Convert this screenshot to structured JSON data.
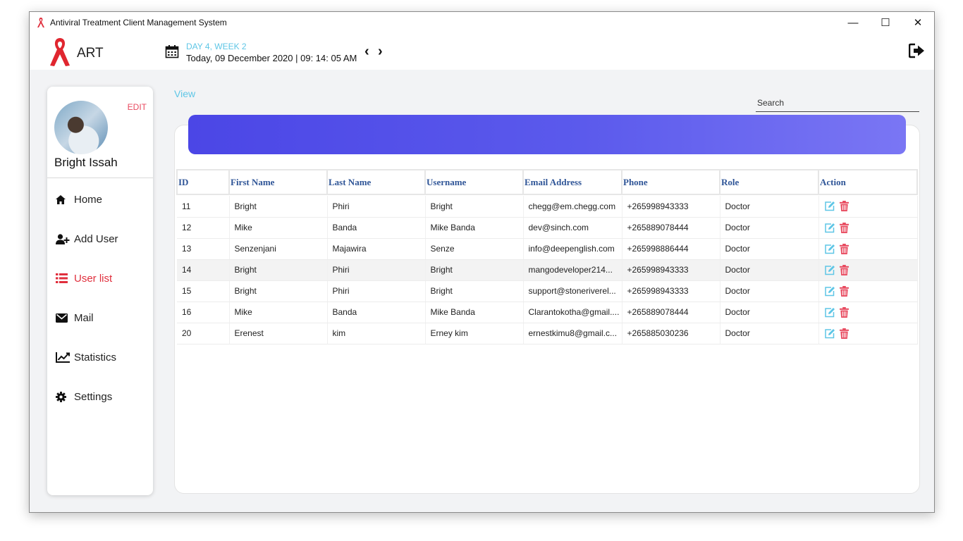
{
  "window": {
    "title": "Antiviral Treatment Client Management System",
    "controls": {
      "minimize": "—",
      "maximize": "☐",
      "close": "✕"
    }
  },
  "header": {
    "brand": "ART",
    "week_label": "DAY 4,  WEEK 2",
    "today": "Today, 09 December 2020  | 09: 14: 05 AM",
    "prev": "‹",
    "next": "›"
  },
  "profile": {
    "name": "Bright Issah",
    "edit_label": "EDIT"
  },
  "sidebar": {
    "items": [
      {
        "label": "Home",
        "icon": "home-icon"
      },
      {
        "label": "Add User",
        "icon": "add-user-icon"
      },
      {
        "label": "User list",
        "icon": "list-icon",
        "active": true
      },
      {
        "label": "Mail",
        "icon": "mail-icon"
      },
      {
        "label": "Statistics",
        "icon": "chart-line-icon"
      },
      {
        "label": "Settings",
        "icon": "gear-icon"
      }
    ]
  },
  "main": {
    "view_label": "View",
    "search_placeholder": "Search",
    "table": {
      "columns": [
        "ID",
        "First Name",
        "Last Name",
        "Username",
        "Email Address",
        "Phone",
        "Role",
        "Action"
      ],
      "rows": [
        [
          "11",
          "Bright",
          "Phiri",
          "Bright",
          "chegg@em.chegg.com",
          "+265998943333",
          "Doctor"
        ],
        [
          "12",
          "Mike",
          "Banda",
          "Mike Banda",
          "dev@sinch.com",
          "+265889078444",
          "Doctor"
        ],
        [
          "13",
          "Senzenjani",
          "Majawira",
          "Senze",
          "info@deepenglish.com",
          "+265998886444",
          "Doctor"
        ],
        [
          "14",
          "Bright",
          "Phiri",
          "Bright",
          "mangodeveloper214...",
          "+265998943333",
          "Doctor"
        ],
        [
          "15",
          "Bright",
          "Phiri",
          "Bright",
          "support@stoneriverel...",
          "+265998943333",
          "Doctor"
        ],
        [
          "16",
          "Mike",
          "Banda",
          "Mike Banda",
          "Clarantokotha@gmail....",
          "+265889078444",
          "Doctor"
        ],
        [
          "20",
          "Erenest",
          "kim",
          "Erney kim",
          "ernestkimu8@gmail.c...",
          "+265885030236",
          "Doctor"
        ]
      ],
      "highlighted_row": 3
    }
  },
  "colors": {
    "accent_red": "#e02f3d",
    "accent_cyan": "#5ec6e6",
    "banner_start": "#4b46e6",
    "banner_end": "#7a76f4",
    "header_blue": "#2f5597"
  }
}
